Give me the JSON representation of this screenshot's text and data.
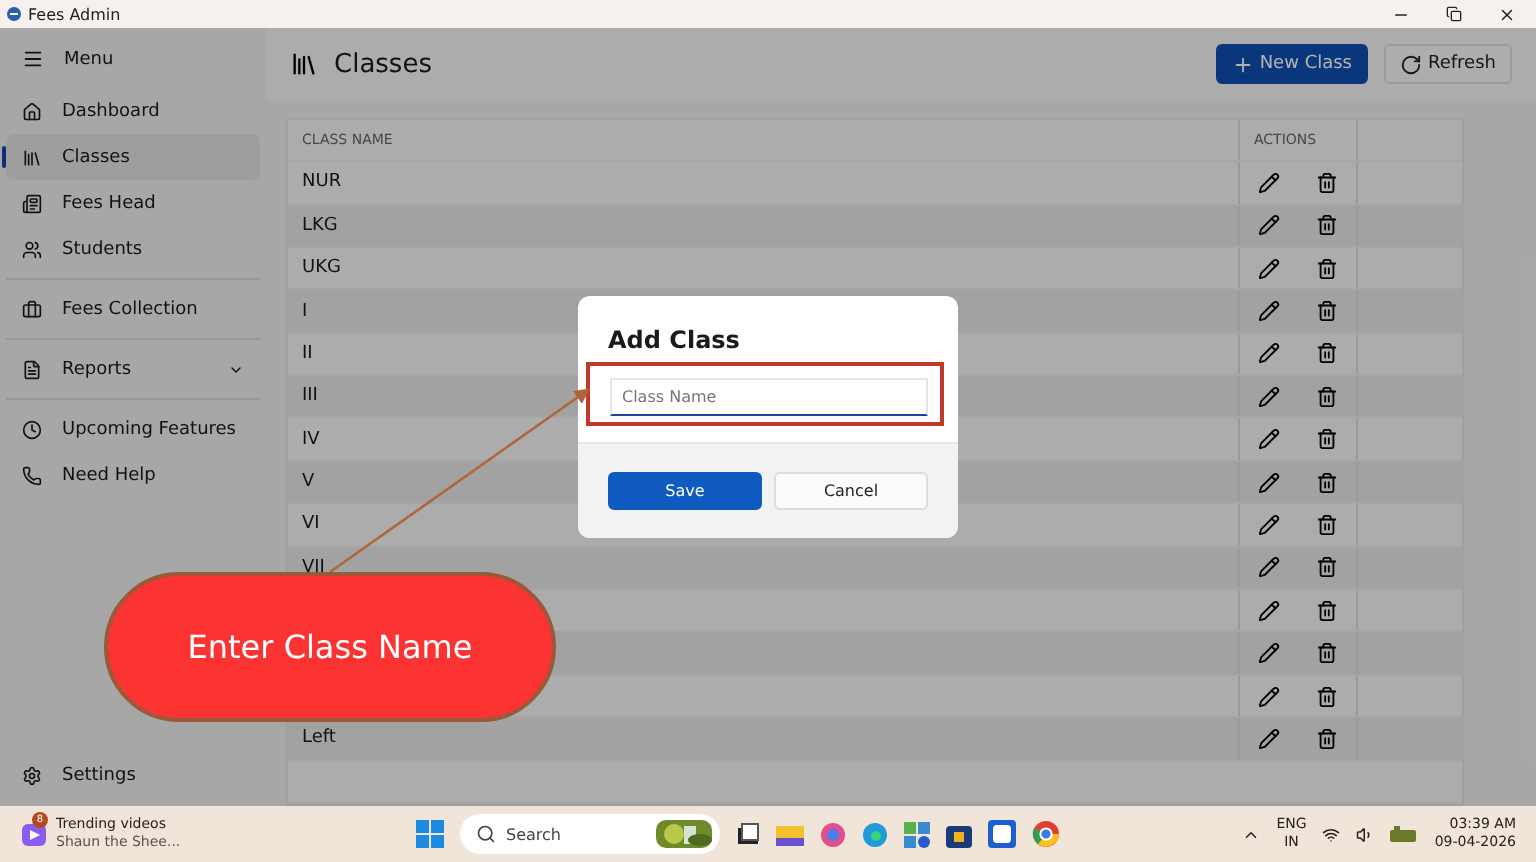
{
  "window": {
    "title": "Fees Admin"
  },
  "sidebar": {
    "menu_label": "Menu",
    "sections": [
      [
        {
          "label": "Dashboard",
          "selected": false
        },
        {
          "label": "Classes",
          "selected": true
        },
        {
          "label": "Fees Head",
          "selected": false
        },
        {
          "label": "Students",
          "selected": false
        }
      ],
      [
        {
          "label": "Fees Collection",
          "selected": false
        }
      ],
      [
        {
          "label": "Reports",
          "selected": false,
          "expandable": true
        }
      ],
      [
        {
          "label": "Upcoming Features",
          "selected": false
        },
        {
          "label": "Need Help",
          "selected": false
        }
      ]
    ],
    "settings": "Settings"
  },
  "page": {
    "title": "Classes",
    "buttons": [
      {
        "label": "New Class",
        "kind": "primary"
      },
      {
        "label": "Refresh",
        "kind": "secondary"
      }
    ]
  },
  "table": {
    "columns": [
      "CLASS NAME",
      "ACTIONS"
    ],
    "rows": [
      {
        "name": "NUR"
      },
      {
        "name": "LKG"
      },
      {
        "name": "UKG"
      },
      {
        "name": "I"
      },
      {
        "name": "II"
      },
      {
        "name": "III"
      },
      {
        "name": "IV"
      },
      {
        "name": "V"
      },
      {
        "name": "VI"
      },
      {
        "name": "VII"
      },
      {},
      {},
      {},
      {
        "name": "Left"
      }
    ]
  },
  "dialog": {
    "title": "Add Class",
    "field": {
      "placeholder": "Class Name"
    },
    "buttons": [
      {
        "label": "Save",
        "kind": "primary"
      },
      {
        "label": "Cancel",
        "kind": "secondary"
      }
    ]
  },
  "callout": {
    "text": "Enter Class Name"
  },
  "taskbar": {
    "widget": {
      "badge": "8",
      "title": "Trending videos",
      "subtitle": "Shaun the Shee..."
    },
    "search": {
      "placeholder": "Search"
    },
    "language": [
      "ENG",
      "IN"
    ],
    "time": "03:39 AM",
    "date": "09-04-2026"
  }
}
